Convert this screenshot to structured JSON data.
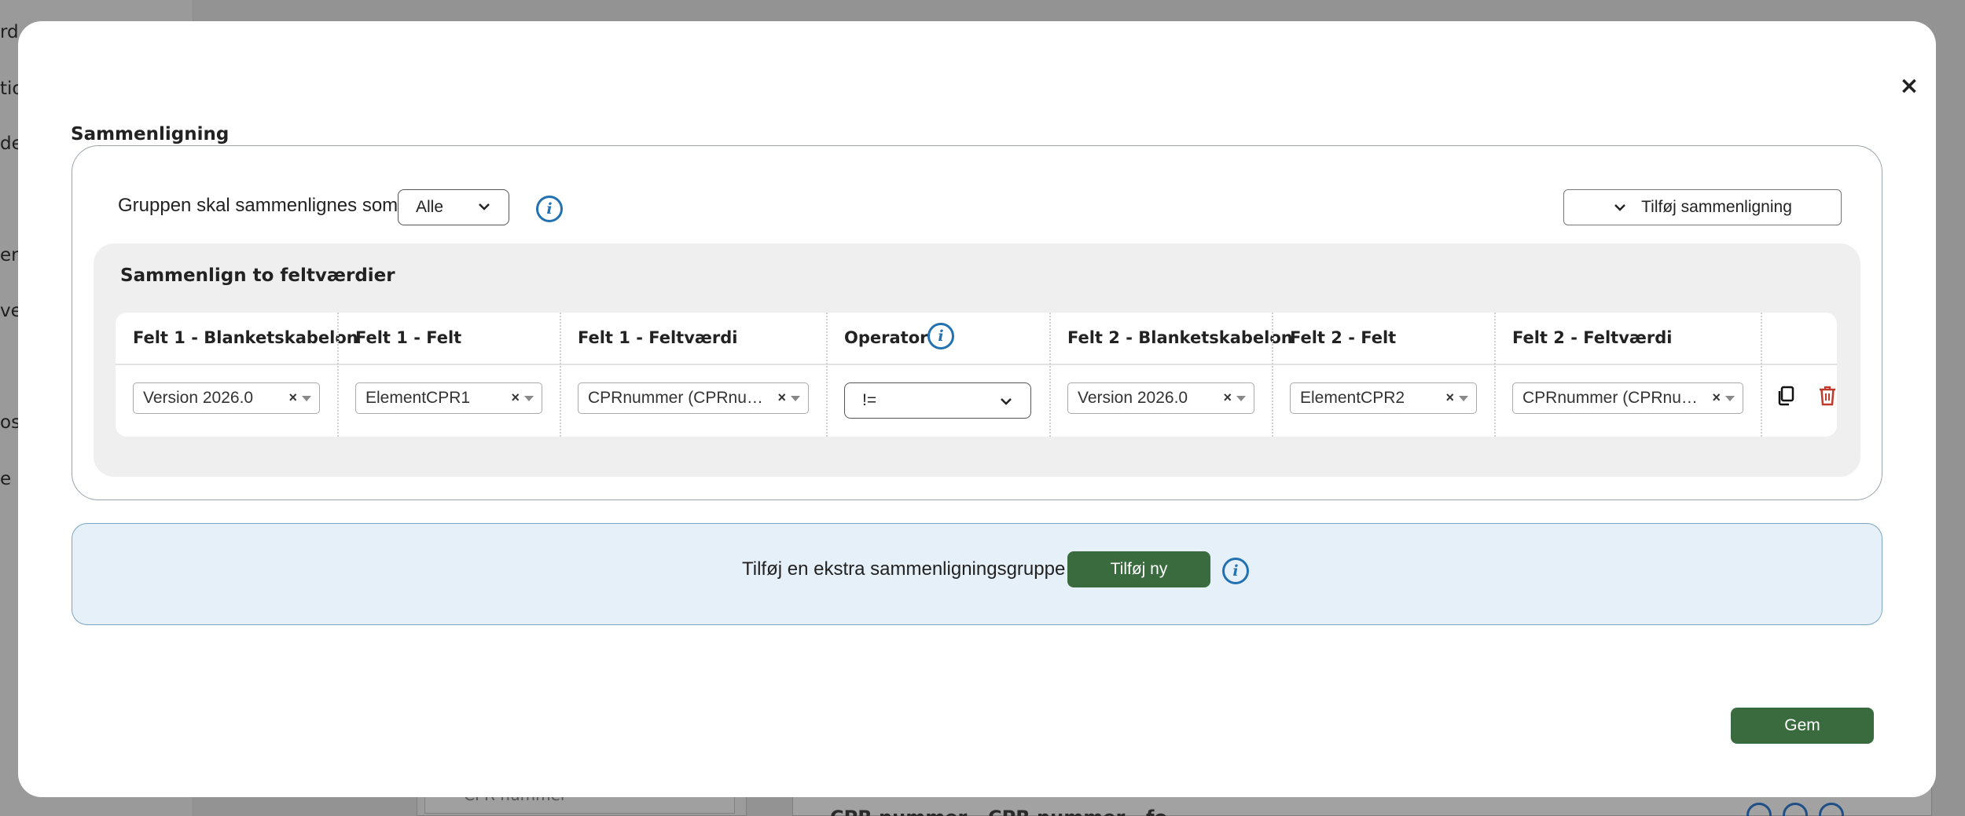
{
  "background": {
    "sidebar_fragments": [
      "rd",
      "tio",
      "de",
      "erl",
      "ver",
      "osa",
      "e"
    ],
    "panel_text": "CPR nummer",
    "card_title": "CPR nummer - CPR nummer - fo..."
  },
  "modal": {
    "title": "Sammenligning",
    "close_label": "×",
    "group": {
      "label": "Gruppen skal sammenlignes som:",
      "select_value": "Alle",
      "add_comparison_label": "Tilføj sammenligning"
    },
    "comparison": {
      "title": "Sammenlign to feltværdier",
      "headers": {
        "f1_form": "Felt 1 - Blanketskabelon",
        "f1_field": "Felt 1 - Felt",
        "f1_value": "Felt 1 - Feltværdi",
        "operator": "Operator",
        "f2_form": "Felt 2 - Blanketskabelon",
        "f2_field": "Felt 2 - Felt",
        "f2_value": "Felt 2 - Feltværdi"
      },
      "row": {
        "f1_form": "Version 2026.0",
        "f1_field": "ElementCPR1",
        "f1_value": "CPRnummer (CPRnummer)",
        "operator": "!=",
        "f2_form": "Version 2026.0",
        "f2_field": "ElementCPR2",
        "f2_value": "CPRnummer (CPRnummer)"
      }
    },
    "extra": {
      "text": "Tilføj en ekstra sammenligningsgruppe",
      "button_label": "Tilføj ny"
    },
    "save_label": "Gem"
  },
  "colors": {
    "accent_green": "#3a6b3f",
    "info_blue": "#2271b1",
    "delete_red": "#c0392b"
  }
}
